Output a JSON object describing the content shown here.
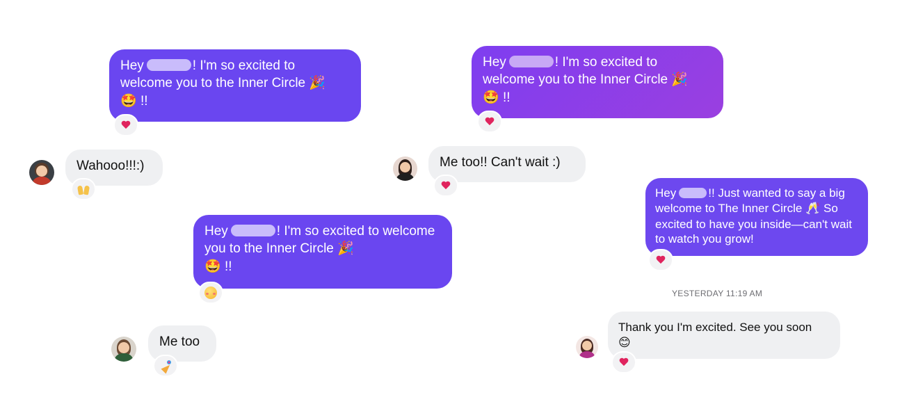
{
  "colors": {
    "outgoing_bubble": "#6a46f0",
    "outgoing_bubble_purple": "#8a3ee6",
    "outgoing_bubble_last": "#6d48ef",
    "incoming_bubble": "#eff0f2",
    "blur_name": "#c9bcfb",
    "reaction_heart": "#e0245e"
  },
  "conversations": [
    {
      "outgoing": {
        "prefix": "Hey",
        "suffix": "! I'm so excited to welcome you to the Inner Circle",
        "trailing": "!!",
        "emoji_icons": [
          "party-popper-icon",
          "star-struck-icon"
        ],
        "reaction": "heart-icon"
      },
      "incoming": {
        "text": "Wahooo!!!:)",
        "reaction": "raising-hands-icon"
      }
    },
    {
      "outgoing": {
        "prefix": "Hey",
        "suffix": "! I'm so excited to welcome you to the Inner Circle",
        "trailing": "!!",
        "emoji_icons": [
          "party-popper-icon",
          "star-struck-icon"
        ],
        "reaction": "heart-icon"
      },
      "incoming": {
        "text": "Me too!! Can't wait :)",
        "reaction": "heart-icon"
      }
    },
    {
      "outgoing": {
        "prefix": "Hey",
        "suffix": "! I'm so excited to welcome you to the Inner Circle",
        "trailing": "!!",
        "emoji_icons": [
          "party-popper-icon",
          "star-struck-icon"
        ],
        "reaction": "smiling-face-with-hearts-icon"
      },
      "incoming": {
        "text": "Me too",
        "reaction": "party-popper-icon"
      }
    },
    {
      "outgoing": {
        "prefix": "Hey",
        "suffix": "!! Just wanted to say a big welcome to The Inner Circle",
        "after_emoji": "So excited to have you inside—can't wait to watch you grow!",
        "emoji_icons": [
          "clinking-glasses-icon"
        ],
        "reaction": "heart-icon"
      },
      "timestamp": "YESTERDAY 11:19 AM",
      "incoming": {
        "text": "Thank you I'm excited. See you soon",
        "emoji_icons": [
          "smiling-face-icon"
        ],
        "reaction": "heart-icon"
      }
    }
  ]
}
